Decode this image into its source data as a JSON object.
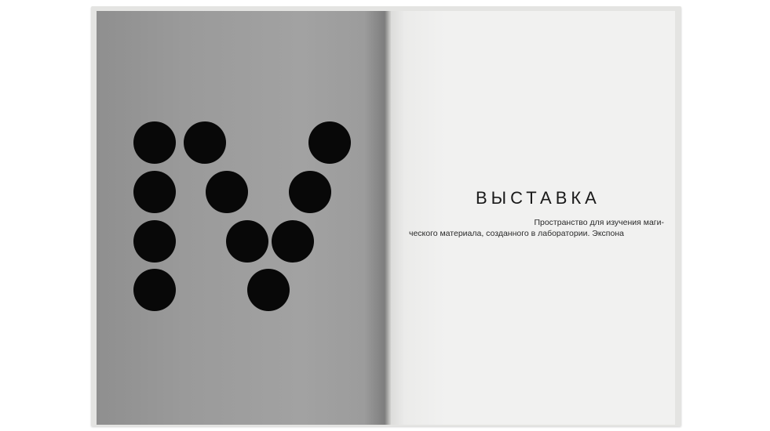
{
  "book": {
    "right_page": {
      "heading": "ВЫСТАВКА",
      "text_line1": "Пространство для изучения маги-",
      "text_line2": "ческого материала, созданного в лаборатории. Экспона"
    },
    "left_page": {
      "dot_color": "#080808",
      "page_color": "#9c9c9c"
    }
  }
}
